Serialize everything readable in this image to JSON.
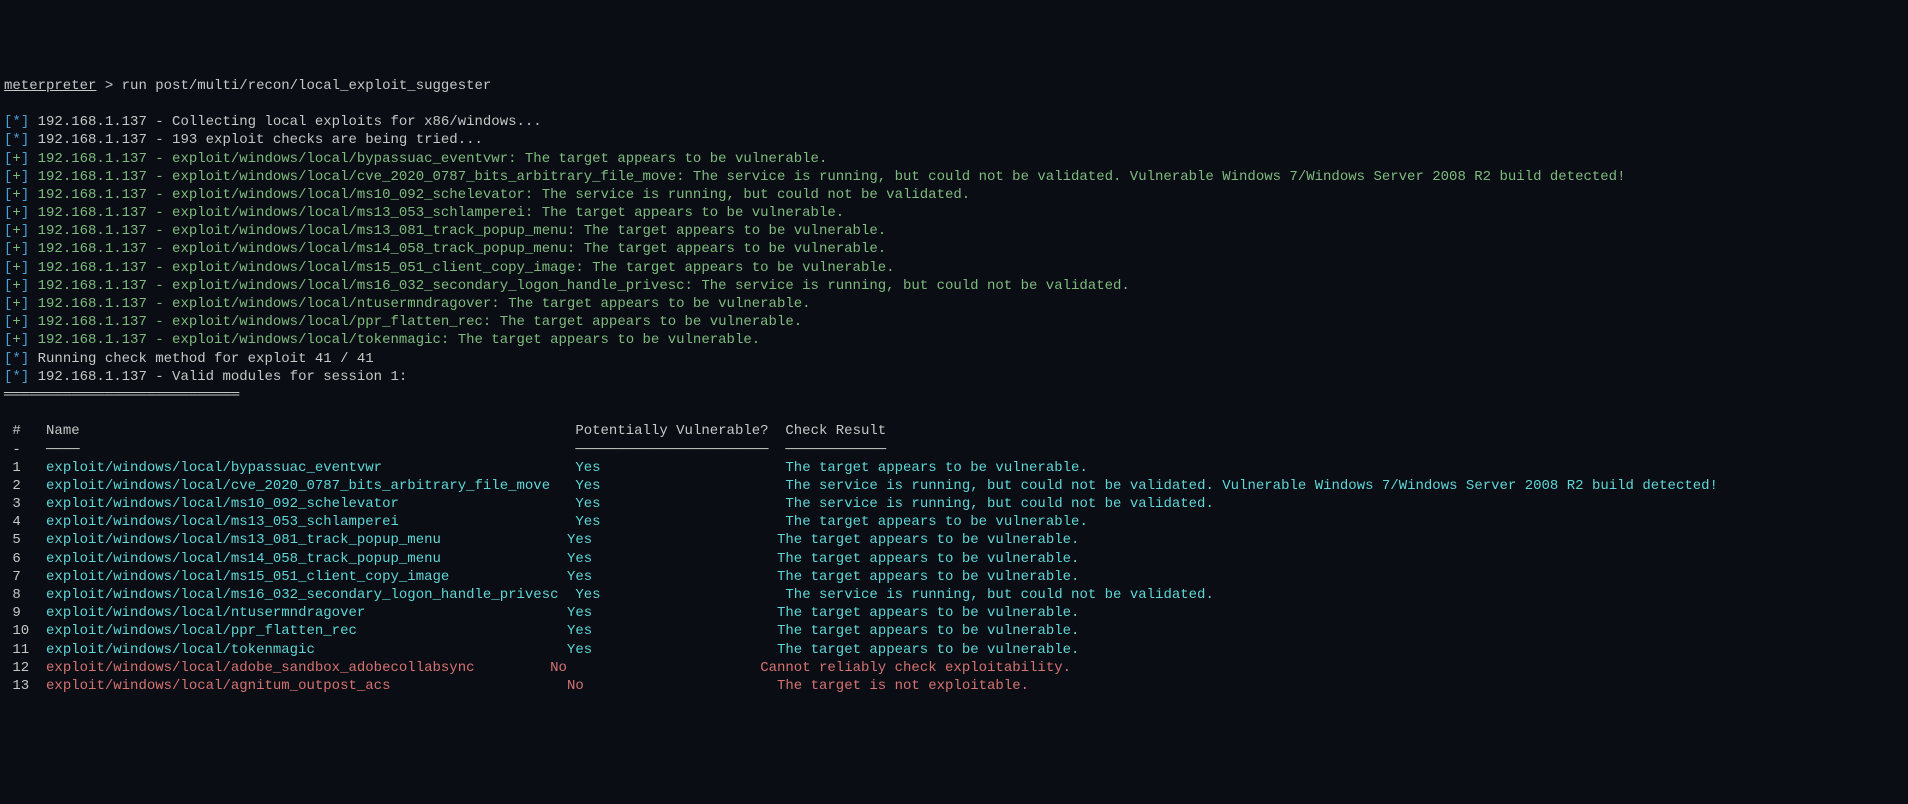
{
  "prompt": "meterpreter",
  "gt": " > ",
  "command": "run post/multi/recon/local_exploit_suggester",
  "ip": "192.168.1.137",
  "lines": {
    "l1": " - Collecting local exploits for x86/windows...",
    "l2": " - 193 exploit checks are being tried...",
    "l3": " - exploit/windows/local/bypassuac_eventvwr: The target appears to be vulnerable.",
    "l4": " - exploit/windows/local/cve_2020_0787_bits_arbitrary_file_move: The service is running, but could not be validated. Vulnerable Windows 7/Windows Server 2008 R2 build detected!",
    "l5": " - exploit/windows/local/ms10_092_schelevator: The service is running, but could not be validated.",
    "l6": " - exploit/windows/local/ms13_053_schlamperei: The target appears to be vulnerable.",
    "l7": " - exploit/windows/local/ms13_081_track_popup_menu: The target appears to be vulnerable.",
    "l8": " - exploit/windows/local/ms14_058_track_popup_menu: The target appears to be vulnerable.",
    "l9": " - exploit/windows/local/ms15_051_client_copy_image: The target appears to be vulnerable.",
    "l10": " - exploit/windows/local/ms16_032_secondary_logon_handle_privesc: The service is running, but could not be validated.",
    "l11": " - exploit/windows/local/ntusermndragover: The target appears to be vulnerable.",
    "l12": " - exploit/windows/local/ppr_flatten_rec: The target appears to be vulnerable.",
    "l13": " - exploit/windows/local/tokenmagic: The target appears to be vulnerable.",
    "l14": "Running check method for exploit 41 / 41",
    "l15": " - Valid modules for session 1:"
  },
  "hr": "════════════════════════════",
  "table": {
    "h1": " #",
    "h2": "Name",
    "h3": "Potentially Vulnerable?",
    "h4": "Check Result",
    "u1": " -",
    "u2": "────",
    "u3": "───────────────────────",
    "u4": "────────────"
  },
  "rows": {
    "r1n": " 1",
    "r1name": "exploit/windows/local/bypassuac_eventvwr",
    "r1v": "Yes",
    "r1r": "The target appears to be vulnerable.",
    "r2n": " 2",
    "r2name": "exploit/windows/local/cve_2020_0787_bits_arbitrary_file_move",
    "r2v": "Yes",
    "r2r": "The service is running, but could not be validated. Vulnerable Windows 7/Windows Server 2008 R2 build detected!",
    "r3n": " 3",
    "r3name": "exploit/windows/local/ms10_092_schelevator",
    "r3v": "Yes",
    "r3r": "The service is running, but could not be validated.",
    "r4n": " 4",
    "r4name": "exploit/windows/local/ms13_053_schlamperei",
    "r4v": "Yes",
    "r4r": "The target appears to be vulnerable.",
    "r5n": " 5",
    "r5name": "exploit/windows/local/ms13_081_track_popup_menu",
    "r5v": "Yes",
    "r5r": "The target appears to be vulnerable.",
    "r6n": " 6",
    "r6name": "exploit/windows/local/ms14_058_track_popup_menu",
    "r6v": "Yes",
    "r6r": "The target appears to be vulnerable.",
    "r7n": " 7",
    "r7name": "exploit/windows/local/ms15_051_client_copy_image",
    "r7v": "Yes",
    "r7r": "The target appears to be vulnerable.",
    "r8n": " 8",
    "r8name": "exploit/windows/local/ms16_032_secondary_logon_handle_privesc",
    "r8v": "Yes",
    "r8r": "The service is running, but could not be validated.",
    "r9n": " 9",
    "r9name": "exploit/windows/local/ntusermndragover",
    "r9v": "Yes",
    "r9r": "The target appears to be vulnerable.",
    "r10n": " 10",
    "r10name": "exploit/windows/local/ppr_flatten_rec",
    "r10v": "Yes",
    "r10r": "The target appears to be vulnerable.",
    "r11n": " 11",
    "r11name": "exploit/windows/local/tokenmagic",
    "r11v": "Yes",
    "r11r": "The target appears to be vulnerable.",
    "r12n": " 12",
    "r12name": "exploit/windows/local/adobe_sandbox_adobecollabsync",
    "r12v": "No",
    "r12r": "Cannot reliably check exploitability.",
    "r13n": " 13",
    "r13name": "exploit/windows/local/agnitum_outpost_acs",
    "r13v": "No",
    "r13r": "The target is not exploitable."
  }
}
